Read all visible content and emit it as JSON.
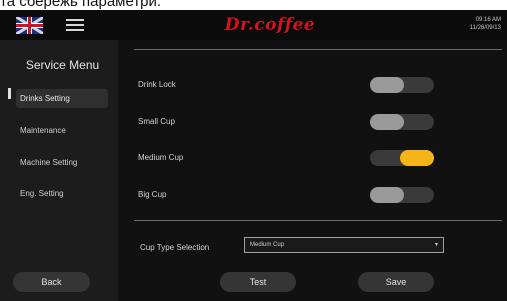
{
  "caption": "та сбережь параметри.",
  "header": {
    "brand": "Dr.coffee",
    "time": "09:16 AM",
    "date": "11/26/09/13"
  },
  "sidebar": {
    "title": "Service Menu",
    "items": [
      {
        "label": "Drinks Setting",
        "active": true
      },
      {
        "label": "Maintenance",
        "active": false
      },
      {
        "label": "Machine Setting",
        "active": false
      },
      {
        "label": "Eng. Setting",
        "active": false
      }
    ],
    "back_label": "Back"
  },
  "settings": [
    {
      "label": "Drink Lock",
      "state": "off"
    },
    {
      "label": "Small Cup",
      "state": "off"
    },
    {
      "label": "Medium Cup",
      "state": "on"
    },
    {
      "label": "Big Cup",
      "state": "off"
    }
  ],
  "cup_type": {
    "label": "Cup Type Selection",
    "value": "Medium Cup"
  },
  "footer": {
    "test_label": "Test",
    "save_label": "Save"
  },
  "colors": {
    "brand": "#d0151d",
    "toggle_on": "#f5b516",
    "toggle_off": "#9a9a9a"
  },
  "icons": {
    "language": "uk-flag-icon",
    "menu": "hamburger-menu-icon",
    "dropdown": "chevron-down-icon"
  }
}
